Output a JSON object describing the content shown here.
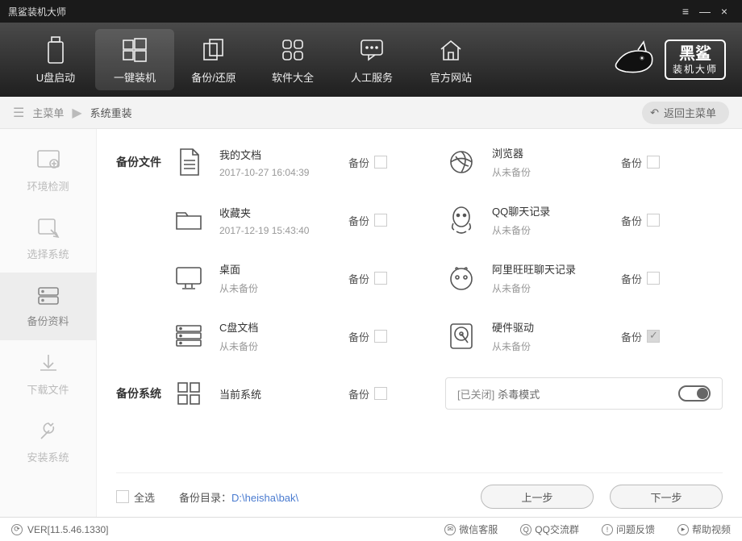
{
  "app_title": "黑鲨装机大师",
  "window_controls": {
    "menu": "≡",
    "min": "—",
    "close": "×"
  },
  "topnav": [
    {
      "id": "usb",
      "label": "U盘启动"
    },
    {
      "id": "reinstall",
      "label": "一键装机",
      "active": true
    },
    {
      "id": "backup",
      "label": "备份/还原"
    },
    {
      "id": "software",
      "label": "软件大全"
    },
    {
      "id": "support",
      "label": "人工服务"
    },
    {
      "id": "site",
      "label": "官方网站"
    }
  ],
  "brand": {
    "line1": "黑鲨",
    "line2": "装机大师"
  },
  "breadcrumb": {
    "root": "主菜单",
    "current": "系统重装",
    "back": "返回主菜单"
  },
  "sidebar": [
    {
      "id": "env",
      "label": "环境检测"
    },
    {
      "id": "sys",
      "label": "选择系统"
    },
    {
      "id": "data",
      "label": "备份资料",
      "active": true
    },
    {
      "id": "dl",
      "label": "下载文件"
    },
    {
      "id": "inst",
      "label": "安装系统"
    }
  ],
  "backup_label": "备份",
  "sections": {
    "files_title": "备份文件",
    "system_title": "备份系统"
  },
  "items": {
    "docs": {
      "name": "我的文档",
      "sub": "2017-10-27 16:04:39"
    },
    "browser": {
      "name": "浏览器",
      "sub": "从未备份"
    },
    "fav": {
      "name": "收藏夹",
      "sub": "2017-12-19 15:43:40"
    },
    "qq": {
      "name": "QQ聊天记录",
      "sub": "从未备份"
    },
    "desktop": {
      "name": "桌面",
      "sub": "从未备份"
    },
    "ali": {
      "name": "阿里旺旺聊天记录",
      "sub": "从未备份"
    },
    "cdrive": {
      "name": "C盘文档",
      "sub": "从未备份"
    },
    "driver": {
      "name": "硬件驱动",
      "sub": "从未备份",
      "checked": true
    },
    "os": {
      "name": "当前系统"
    }
  },
  "antivirus": {
    "state": "[已关闭]",
    "label": "杀毒模式"
  },
  "footer": {
    "select_all": "全选",
    "path_label": "备份目录：",
    "path_value": "D:\\heisha\\bak\\",
    "prev": "上一步",
    "next": "下一步"
  },
  "statusbar": {
    "version": "VER[11.5.46.1330]",
    "links": [
      "微信客服",
      "QQ交流群",
      "问题反馈",
      "帮助视频"
    ]
  }
}
